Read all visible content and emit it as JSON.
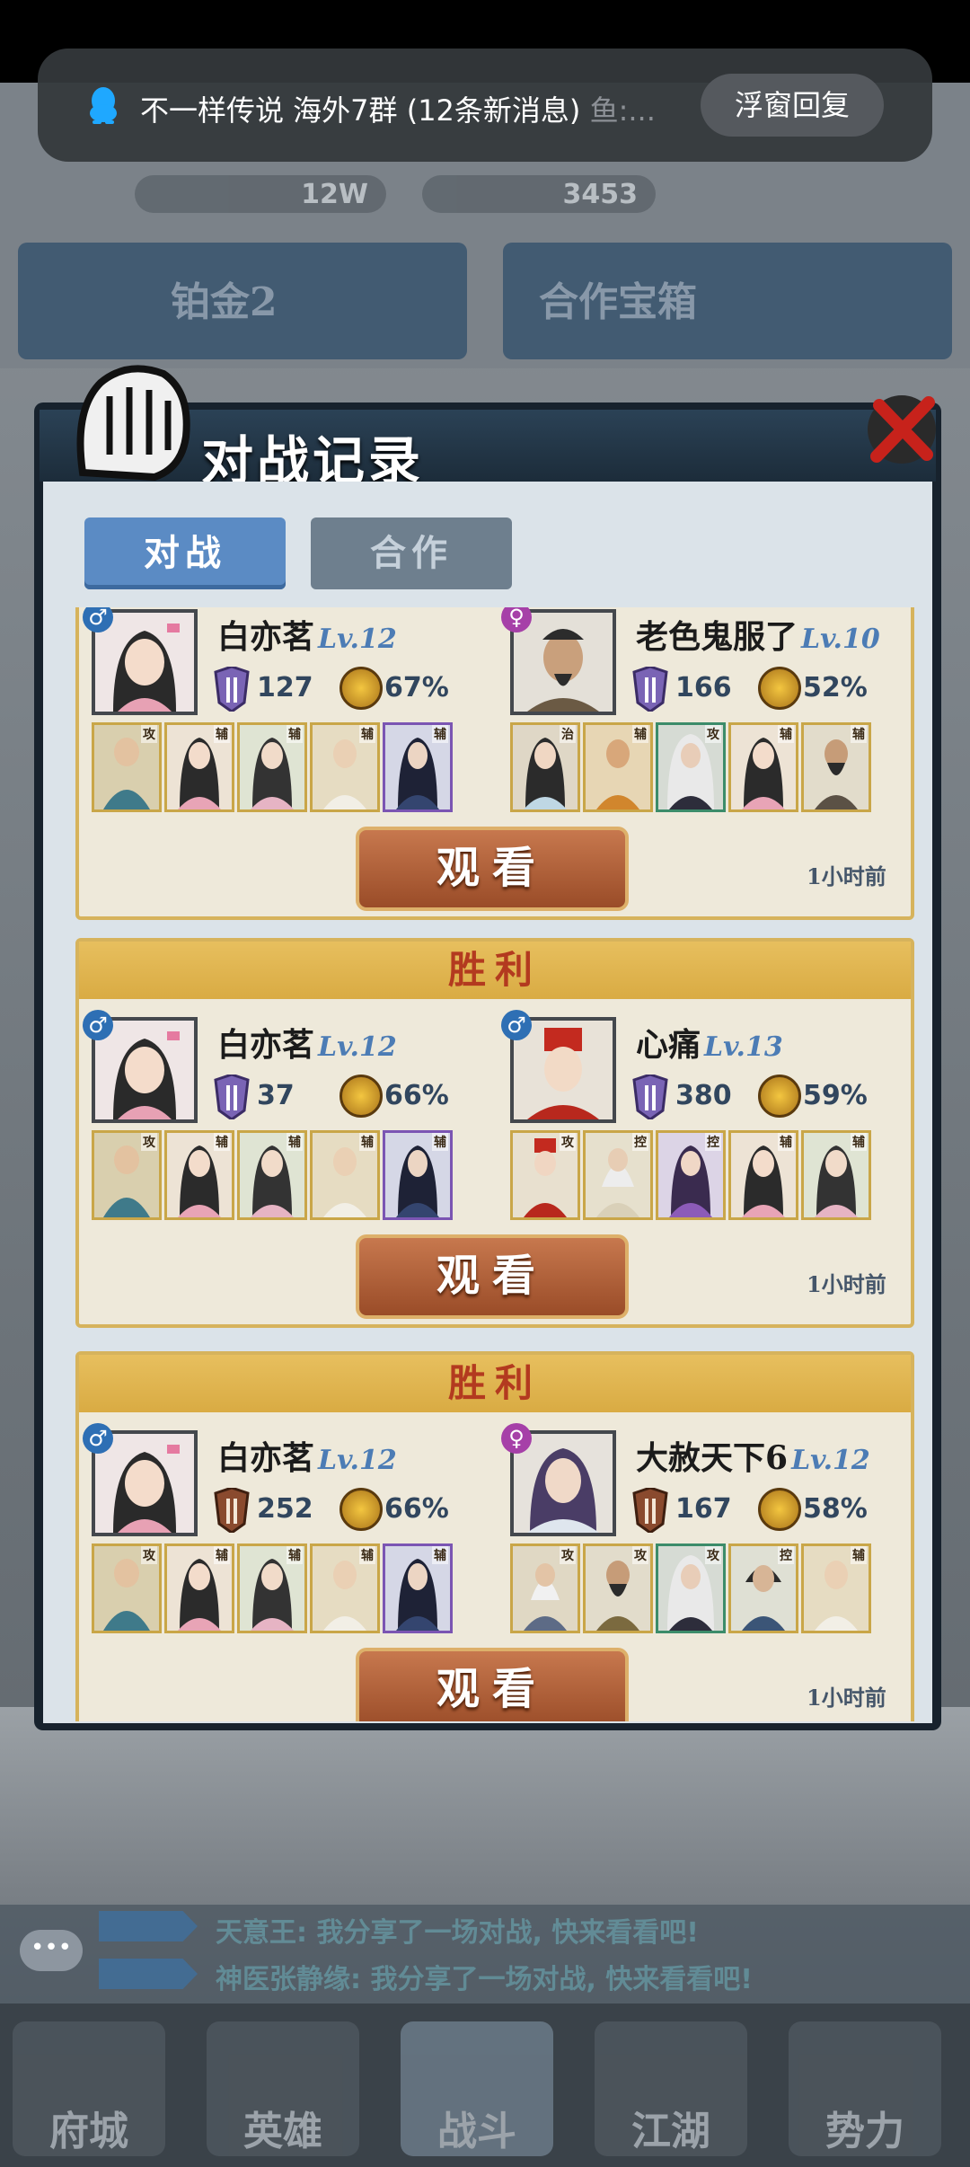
{
  "notification": {
    "title": "不一样传说 海外7群 (12条新消息)",
    "sender": "鱼:...",
    "button": "浮窗回复"
  },
  "dialog": {
    "title": "对战记录",
    "tabs": [
      "对战",
      "合作"
    ]
  },
  "records": [
    {
      "result": "",
      "left": {
        "gender": "♂",
        "name": "白亦茗",
        "level": "Lv.12",
        "power": "127",
        "win_rate": "67%",
        "heroes": [
          "攻",
          "辅",
          "辅",
          "辅",
          "辅"
        ]
      },
      "right": {
        "gender": "♀",
        "name": "老色鬼服了",
        "level": "Lv.10",
        "power": "166",
        "win_rate": "52%",
        "heroes": [
          "治",
          "辅",
          "攻",
          "辅",
          "辅"
        ]
      },
      "watch": "观看",
      "time": "1小时前"
    },
    {
      "result": "胜利",
      "left": {
        "gender": "♂",
        "name": "白亦茗",
        "level": "Lv.12",
        "power": "37",
        "win_rate": "66%",
        "heroes": [
          "攻",
          "辅",
          "辅",
          "辅",
          "辅"
        ]
      },
      "right": {
        "gender": "♂",
        "name": "心痛",
        "level": "Lv.13",
        "power": "380",
        "win_rate": "59%",
        "heroes": [
          "攻",
          "控",
          "控",
          "辅",
          "辅"
        ]
      },
      "watch": "观看",
      "time": "1小时前"
    },
    {
      "result": "胜利",
      "left": {
        "gender": "♂",
        "name": "白亦茗",
        "level": "Lv.12",
        "power": "252",
        "win_rate": "66%",
        "heroes": [
          "攻",
          "辅",
          "辅",
          "辅",
          "辅"
        ]
      },
      "right": {
        "gender": "♀",
        "name": "大赦天下6",
        "level": "Lv.12",
        "power": "167",
        "win_rate": "58%",
        "heroes": [
          "攻",
          "攻",
          "攻",
          "控",
          "辅"
        ]
      },
      "watch": "观看",
      "time": "1小时前"
    }
  ],
  "background": {
    "banners": [
      "铂金2",
      "合作宝箱"
    ],
    "resources": [
      "12W",
      "3453"
    ],
    "chat_lines": [
      "天意王: 我分享了一场对战, 快来看看吧!",
      "神医张静缘: 我分享了一场对战, 快来看看吧!"
    ],
    "nav": [
      "府城",
      "英雄",
      "战斗",
      "江湖",
      "势力"
    ]
  },
  "colors": {
    "accent_blue": "#5b8bc4",
    "victory_red": "#b33a1f",
    "card_gold": "#d6b35c",
    "watch_button": "#a9562f"
  }
}
